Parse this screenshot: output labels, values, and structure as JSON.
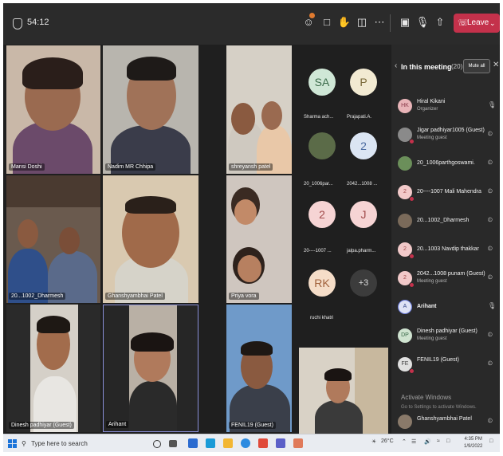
{
  "meeting": {
    "timer": "54:12",
    "leave_label": "Leave",
    "accent": "#c4314b"
  },
  "video_tiles": [
    {
      "name": "Mansi Doshi"
    },
    {
      "name": "Nadim MR Chhipa"
    },
    {
      "name": "shreyansh patel"
    },
    {
      "name": "20...1002_Dharmesh"
    },
    {
      "name": "Ghanshyambhai Patel"
    },
    {
      "name": "Priya vora"
    },
    {
      "name": "Dinesh padhiyar (Guest)"
    },
    {
      "name": "Arihant"
    },
    {
      "name": "FENIL19 (Guest)"
    }
  ],
  "avatar_tiles": [
    {
      "initials": "SA",
      "name": "Sharma ach..."
    },
    {
      "initials": "P",
      "name": "Prajapati.A."
    },
    {
      "initials": "",
      "name": "20_1006par..."
    },
    {
      "initials": "2",
      "name": "2042...1008 ..."
    },
    {
      "initials": "2",
      "name": "20----1007 ..."
    },
    {
      "initials": "J",
      "name": "jalpa.pharm..."
    },
    {
      "initials": "RK",
      "name": "ruchi khatri"
    },
    {
      "initials": "+3",
      "name": ""
    }
  ],
  "panel": {
    "title": "In this meeting",
    "count": "(20)",
    "mute_all": "Mute all",
    "participants": [
      {
        "initials": "HK",
        "name": "Hiral Kikani",
        "sub": "Organizer",
        "color": "#e8b4b8"
      },
      {
        "initials": "",
        "name": "Jigar padhiyar1005 (Guest)",
        "sub": "Meeting guest",
        "color": "#8a8a8a"
      },
      {
        "initials": "",
        "name": "20_1006parthgoswami.",
        "sub": "",
        "color": "#6b8f5a"
      },
      {
        "initials": "2",
        "name": "20----1007 Mali Mahendra",
        "sub": "",
        "color": "#f2c9c9"
      },
      {
        "initials": "",
        "name": "20...1002_Dharmesh",
        "sub": "",
        "color": "#7a6a5a"
      },
      {
        "initials": "2",
        "name": "20...1003 Navdip thakkar",
        "sub": "",
        "color": "#f2c9c9"
      },
      {
        "initials": "2",
        "name": "2042...1008 punam (Guest)",
        "sub": "Meeting guest",
        "color": "#f2c9c9"
      },
      {
        "initials": "A",
        "name": "Arihant",
        "sub": "",
        "color": "#dfe3f5"
      },
      {
        "initials": "DP",
        "name": "Dinesh padhiyar (Guest)",
        "sub": "Meeting guest",
        "color": "#cfe3d0"
      },
      {
        "initials": "FE",
        "name": "FENIL19 (Guest)",
        "sub": "",
        "color": "#e0e0e0"
      },
      {
        "initials": "",
        "name": "Ghanshyambhai Patel",
        "sub": "",
        "color": "#8a7a6a"
      }
    ],
    "watermark_title": "Activate Windows",
    "watermark_sub": "Go to Settings to activate Windows."
  },
  "taskbar": {
    "search_placeholder": "Type here to search",
    "weather": "26°C",
    "time": "4:35 PM",
    "date": "1/9/2022"
  }
}
